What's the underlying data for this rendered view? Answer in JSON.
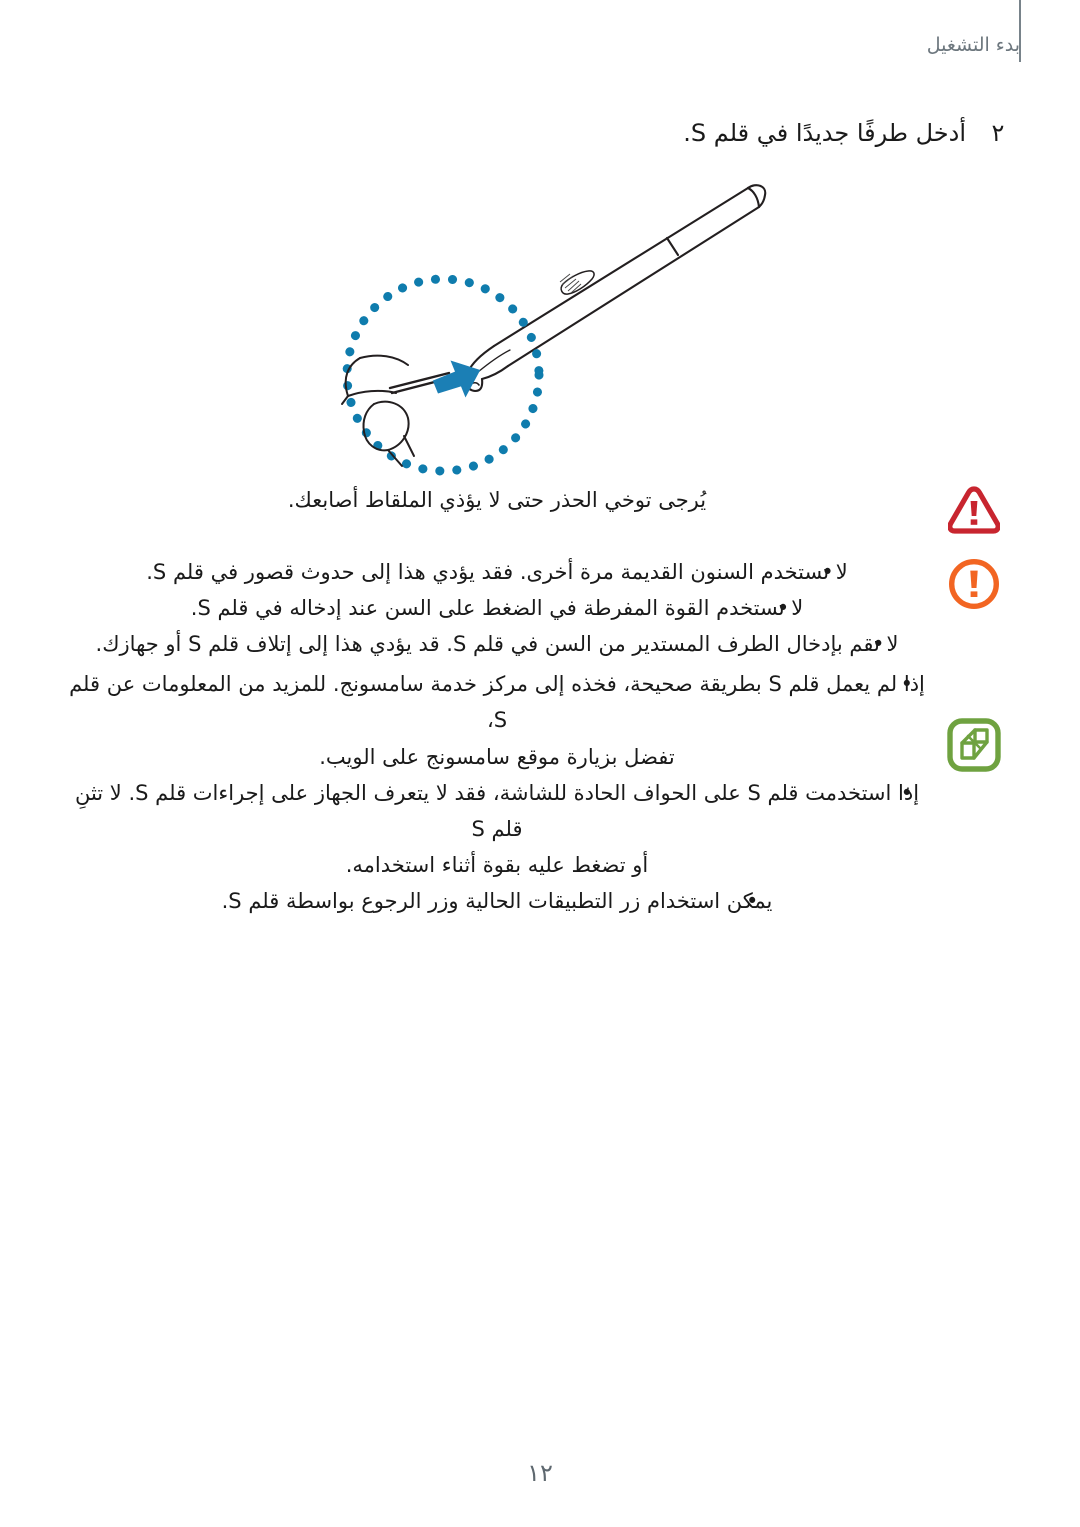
{
  "document": {
    "language": "ar",
    "header_title": "بدء التشغيل",
    "page_number": "١٢"
  },
  "step": {
    "number": "٢",
    "text": "أدخل طرفًا جديدًا في قلم S."
  },
  "illustration": {
    "name": "s-pen-nib-replacement-diagram",
    "accent_color": "#0f7cad",
    "outline_color": "#231f20",
    "elements": [
      "s-pen-body",
      "s-pen-grip-texture",
      "dotted-zoom-circle",
      "insertion-arrow",
      "tweezers-with-nib"
    ]
  },
  "notices": [
    {
      "type": "warning",
      "icon": "warning-triangle-icon",
      "icon_color": "#c8252f",
      "lines": [
        "يُرجى توخي الحذر حتى لا يؤذي الملقاط أصابعك."
      ]
    },
    {
      "type": "caution",
      "icon": "caution-circle-icon",
      "icon_color": "#f26522",
      "bullets": [
        {
          "lines": [
            "لا تستخدم السنون القديمة مرة أخرى. فقد يؤدي هذا إلى حدوث قصور في قلم S."
          ]
        },
        {
          "lines": [
            "لا تستخدم القوة المفرطة في الضغط على السن عند إدخاله في قلم S."
          ]
        },
        {
          "lines": [
            "لا تقم بإدخال الطرف المستدير من السن في قلم S. قد يؤدي هذا إلى إتلاف قلم S أو جهازك."
          ]
        }
      ]
    },
    {
      "type": "note",
      "icon": "note-pencil-icon",
      "icon_color": "#6fa240",
      "bullets": [
        {
          "lines": [
            "إذا لم يعمل قلم S بطريقة صحيحة، فخذه إلى مركز خدمة سامسونج. للمزيد من المعلومات عن قلم S،",
            "تفضل بزيارة موقع سامسونج على الويب."
          ]
        },
        {
          "lines": [
            "إذا استخدمت قلم S على الحواف الحادة للشاشة، فقد لا يتعرف الجهاز على إجراءات قلم S. لا تثنِ قلم S",
            "أو تضغط عليه بقوة أثناء استخدامه."
          ]
        },
        {
          "lines": [
            "يمكن استخدام زر التطبيقات الحالية وزر الرجوع بواسطة قلم S."
          ]
        }
      ]
    }
  ]
}
